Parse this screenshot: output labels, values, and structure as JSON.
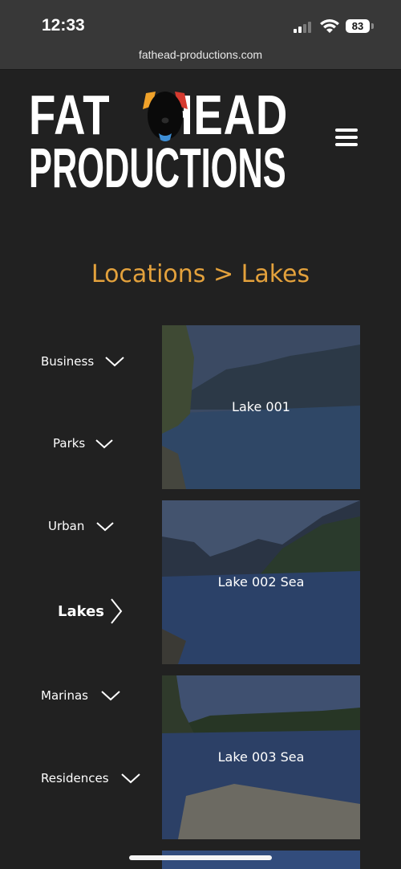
{
  "status_bar": {
    "time": "12:33",
    "battery": "83"
  },
  "browser": {
    "url": "fathead-productions.com"
  },
  "site": {
    "logo_line1": "FAT HEAD",
    "logo_line2": "PRODUCTIONS",
    "menu_icon": "hamburger-menu-icon"
  },
  "page": {
    "heading": "Locations > Lakes",
    "accent_color": "#e3a13c"
  },
  "categories": [
    {
      "label": "Business",
      "icon": "chevron-down-icon"
    },
    {
      "label": "Parks",
      "icon": "chevron-down-icon"
    },
    {
      "label": "Urban",
      "icon": "chevron-down-icon"
    },
    {
      "label": "Lakes",
      "icon": "chevron-right-icon",
      "active": true
    },
    {
      "label": "Marinas",
      "icon": "chevron-down-icon"
    },
    {
      "label": "Residences",
      "icon": "chevron-down-icon"
    }
  ],
  "locations": [
    {
      "title": "Lake 001"
    },
    {
      "title": "Lake 002 Sea"
    },
    {
      "title": "Lake 003 Sea"
    }
  ]
}
